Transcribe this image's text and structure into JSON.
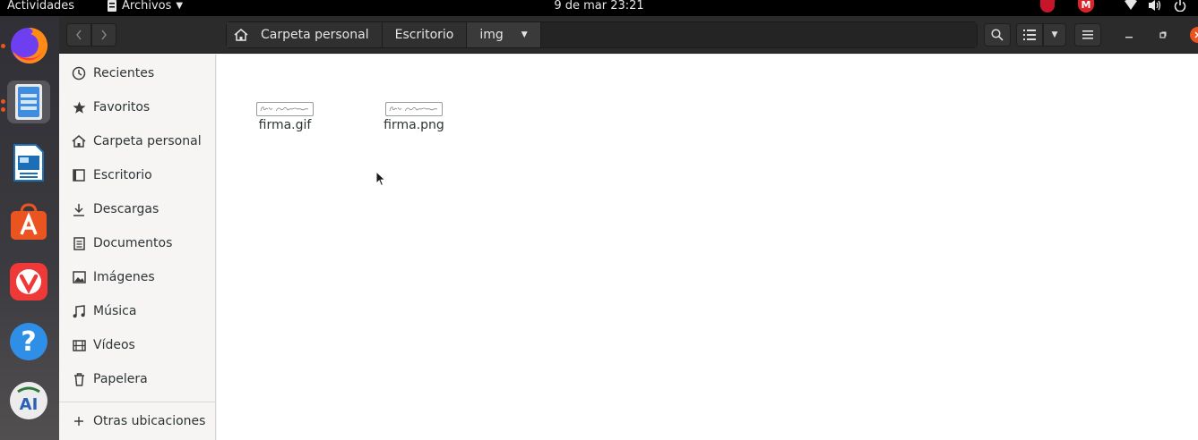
{
  "topbar": {
    "activities": "Actividades",
    "app_menu": "Archivos",
    "clock": "9 de mar  23:21",
    "tray_m_label": "M"
  },
  "dock": {
    "items": [
      {
        "name": "firefox",
        "icon": "firefox-icon",
        "running": true
      },
      {
        "name": "files",
        "icon": "files-icon",
        "running": true,
        "active": true
      },
      {
        "name": "writer",
        "icon": "writer-icon"
      },
      {
        "name": "software",
        "icon": "app-store-icon"
      },
      {
        "name": "vivaldi",
        "icon": "vivaldi-icon"
      },
      {
        "name": "help",
        "icon": "help-icon"
      },
      {
        "name": "ai-app",
        "icon": "ai-app-icon"
      }
    ]
  },
  "header": {
    "path": [
      "Carpeta personal",
      "Escritorio",
      "img"
    ]
  },
  "sidebar": {
    "items": [
      {
        "label": "Recientes",
        "icon": "clock-icon"
      },
      {
        "label": "Favoritos",
        "icon": "star-icon"
      },
      {
        "label": "Carpeta personal",
        "icon": "home-icon"
      },
      {
        "label": "Escritorio",
        "icon": "desktop-icon"
      },
      {
        "label": "Descargas",
        "icon": "download-icon"
      },
      {
        "label": "Documentos",
        "icon": "document-icon"
      },
      {
        "label": "Imágenes",
        "icon": "image-icon"
      },
      {
        "label": "Música",
        "icon": "music-icon"
      },
      {
        "label": "Vídeos",
        "icon": "video-icon"
      },
      {
        "label": "Papelera",
        "icon": "trash-icon"
      },
      {
        "label": "Otras ubicaciones",
        "icon": "plus-icon"
      }
    ]
  },
  "files": [
    {
      "name": "firma.gif"
    },
    {
      "name": "firma.png"
    }
  ],
  "colors": {
    "accent": "#e95420",
    "close": "#e95420"
  }
}
